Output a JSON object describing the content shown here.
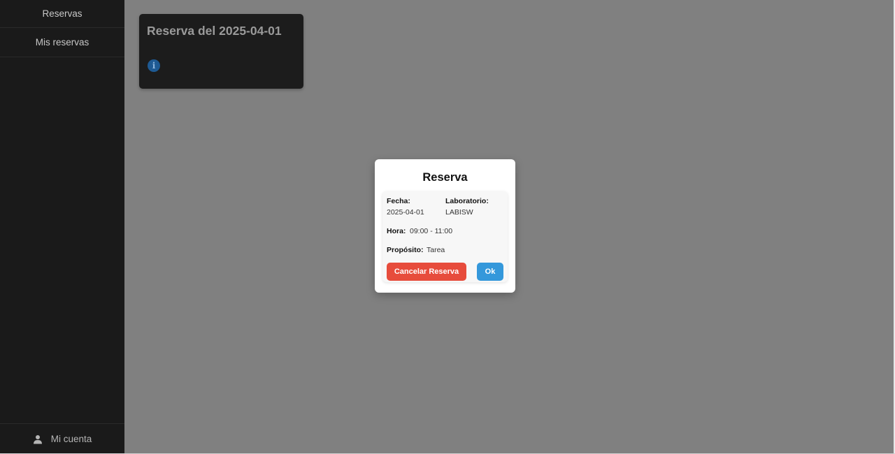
{
  "sidebar": {
    "items": [
      {
        "label": "Reservas"
      },
      {
        "label": "Mis reservas"
      }
    ],
    "account": {
      "label": "Mi cuenta",
      "icon": "user-icon"
    }
  },
  "card": {
    "title": "Reserva del 2025-04-01",
    "info_icon_glyph": "i",
    "info_icon": "info-icon"
  },
  "modal": {
    "title": "Reserva",
    "fecha_label": "Fecha:",
    "fecha_value": "2025-04-01",
    "laboratorio_label": "Laboratorio:",
    "laboratorio_value": "LABISW",
    "hora_label": "Hora:",
    "hora_value": "09:00 - 11:00",
    "proposito_label": "Propósito:",
    "proposito_value": "Tarea",
    "cancel_label": "Cancelar Reserva",
    "ok_label": "Ok"
  },
  "colors": {
    "sidebar_bg": "#1a1a1a",
    "overlay_bg": "#808080",
    "cancel": "#e74c3c",
    "ok": "#3498db"
  }
}
